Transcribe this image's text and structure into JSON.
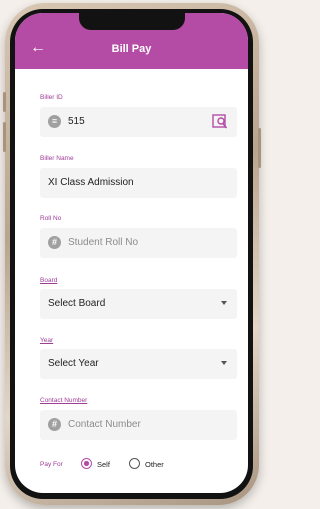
{
  "header": {
    "title": "Bill Pay",
    "back_icon": "back-arrow-icon"
  },
  "form": {
    "biller_id": {
      "label": "Biller ID",
      "value": "515",
      "icon": "biller-icon",
      "action_icon": "scan-code-icon"
    },
    "biller_name": {
      "label": "Biller Name",
      "value": "XI Class Admission"
    },
    "roll_no": {
      "label": "Roll No",
      "placeholder": "Student Roll No",
      "icon": "hash-icon"
    },
    "board": {
      "label": "Board",
      "value": "Select Board"
    },
    "year": {
      "label": "Year",
      "value": "Select Year"
    },
    "contact": {
      "label": "Contact Number",
      "placeholder": "Contact Number",
      "icon": "hash-icon"
    },
    "pay_for": {
      "label": "Pay For",
      "options": [
        "Self",
        "Other"
      ],
      "selected": "Self"
    }
  },
  "colors": {
    "accent": "#b44ca6",
    "label": "#9c3d96",
    "field_bg": "#f4f4f4"
  }
}
